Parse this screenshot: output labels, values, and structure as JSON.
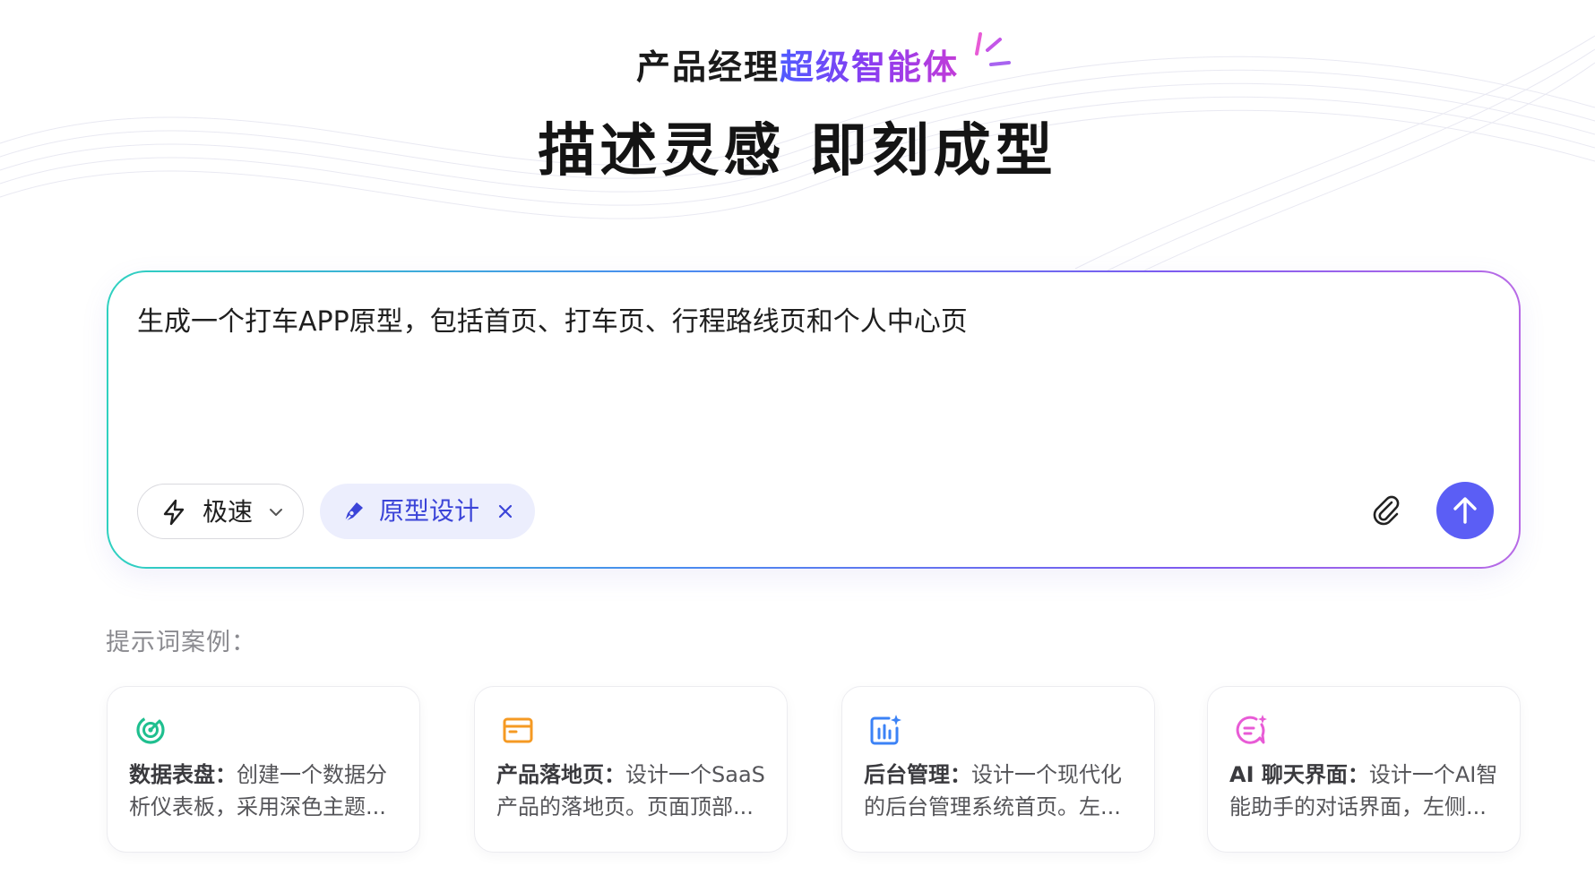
{
  "header": {
    "subtitle_plain": "产品经理",
    "subtitle_accent": "超级智能体",
    "title": "描述灵感 即刻成型"
  },
  "composer": {
    "prompt_text": "生成一个打车APP原型，包括首页、打车页、行程路线页和个人中心页",
    "mode_label": "极速",
    "tag_label": "原型设计",
    "colors": {
      "send_button": "#5b5ef5",
      "tag_bg": "#eceefd",
      "tag_text": "#3b44d8",
      "border_gradient": [
        "#2fd1c0",
        "#4a8cf0",
        "#7c5cf0",
        "#b86ae6"
      ]
    },
    "icons": {
      "mode": "lightning-icon",
      "mode_dropdown": "chevron-down-icon",
      "tag": "pen-icon",
      "tag_remove": "close-icon",
      "attach": "paperclip-icon",
      "send": "arrow-up-icon"
    }
  },
  "examples": {
    "label": "提示词案例：",
    "cards": [
      {
        "title": "数据表盘：",
        "body": "创建一个数据分析仪表板，采用深色主题...",
        "icon": "gauge-icon",
        "icon_color": "#1fbf8f"
      },
      {
        "title": "产品落地页：",
        "body": "设计一个SaaS产品的落地页。页面顶部...",
        "icon": "browser-window-icon",
        "icon_color": "#f59a23"
      },
      {
        "title": "后台管理：",
        "body": "设计一个现代化的后台管理系统首页。左...",
        "icon": "bar-chart-sparkle-icon",
        "icon_color": "#3b82f6"
      },
      {
        "title": "AI 聊天界面：",
        "body": "设计一个AI智能助手的对话界面，左侧...",
        "icon": "chat-sparkle-icon",
        "icon_color": "#e85bd6"
      }
    ]
  }
}
